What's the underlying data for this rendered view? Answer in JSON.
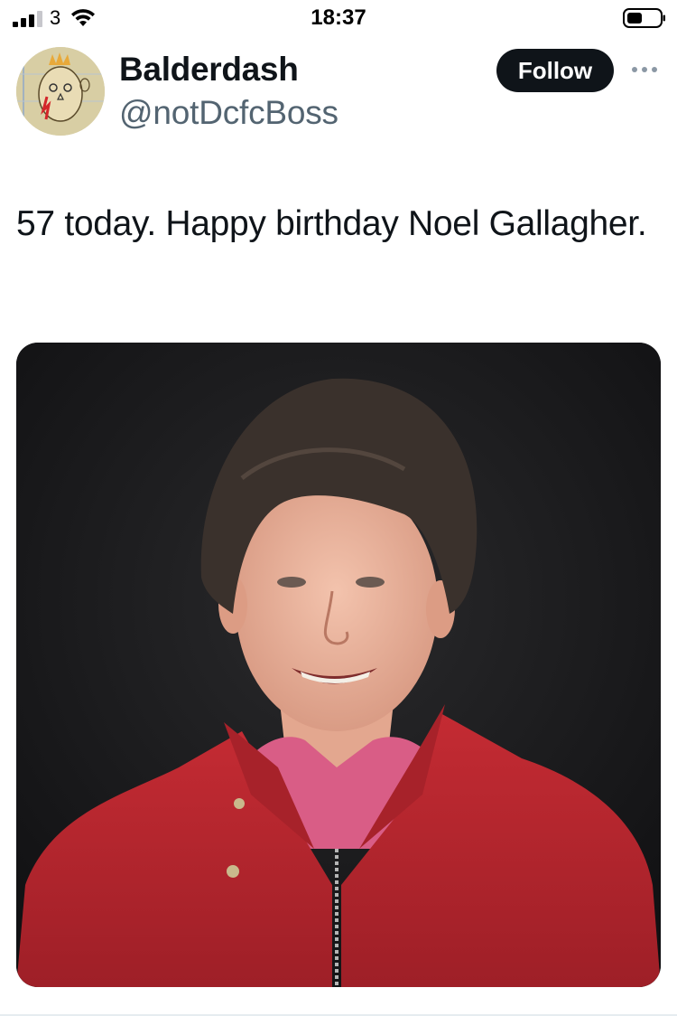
{
  "status_bar": {
    "carrier": "3",
    "time": "18:37",
    "signal_icon": "cellular-signal-icon",
    "wifi_icon": "wifi-icon",
    "battery_icon": "battery-icon"
  },
  "tweet": {
    "display_name": "Balderdash",
    "handle": "@notDcfcBoss",
    "follow_label": "Follow",
    "more_icon": "more-dots-icon",
    "text": "57 today. Happy birthday Noel Gallagher.",
    "media_icon": "photo-portrait-image"
  },
  "colors": {
    "follow_bg": "#0f1419",
    "handle": "#536471",
    "text": "#0f1419",
    "photo_bg": "#1c1b1d",
    "jacket": "#b8252c"
  }
}
